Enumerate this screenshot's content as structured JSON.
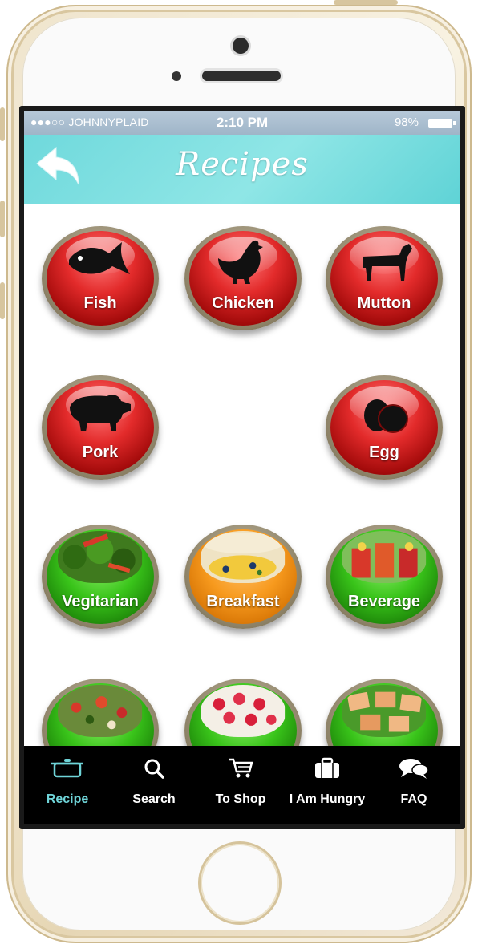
{
  "status_bar": {
    "carrier": "●●●○○ JOHNNYPLAID",
    "time": "2:10 PM",
    "battery": "98%"
  },
  "header": {
    "title": "Recipes",
    "back_icon": "back-arrow-icon"
  },
  "categories": [
    {
      "label": "Fish",
      "style": "red",
      "icon": "fish-icon"
    },
    {
      "label": "Chicken",
      "style": "red",
      "icon": "chicken-icon"
    },
    {
      "label": "Mutton",
      "style": "red",
      "icon": "goat-icon"
    },
    {
      "label": "Pork",
      "style": "red",
      "icon": "pig-icon"
    },
    {
      "label": "Egg",
      "style": "red",
      "icon": "egg-icon"
    },
    {
      "label": "Vegitarian",
      "style": "green",
      "icon": "vegetable-photo"
    },
    {
      "label": "Breakfast",
      "style": "orange",
      "icon": "breakfast-photo"
    },
    {
      "label": "Beverage",
      "style": "green",
      "icon": "beverage-photo"
    },
    {
      "label": "",
      "style": "green",
      "icon": "salad-photo"
    },
    {
      "label": "",
      "style": "green",
      "icon": "strawberry-dessert-photo"
    },
    {
      "label": "",
      "style": "green",
      "icon": "pastry-photo"
    }
  ],
  "tabs": [
    {
      "label": "Recipe",
      "icon": "pot-icon",
      "active": true
    },
    {
      "label": "Search",
      "icon": "search-icon",
      "active": false
    },
    {
      "label": "To Shop",
      "icon": "cart-icon",
      "active": false
    },
    {
      "label": "I Am Hungry",
      "icon": "briefcase-icon",
      "active": false
    },
    {
      "label": "FAQ",
      "icon": "chat-bubbles-icon",
      "active": false
    }
  ],
  "colors": {
    "header": "#6fd9dc",
    "active_tab": "#6fd4d8",
    "tabbar": "#000000",
    "red_orb": "#e32b2b",
    "green_orb": "#39c41a",
    "orange_orb": "#f79a1e"
  }
}
